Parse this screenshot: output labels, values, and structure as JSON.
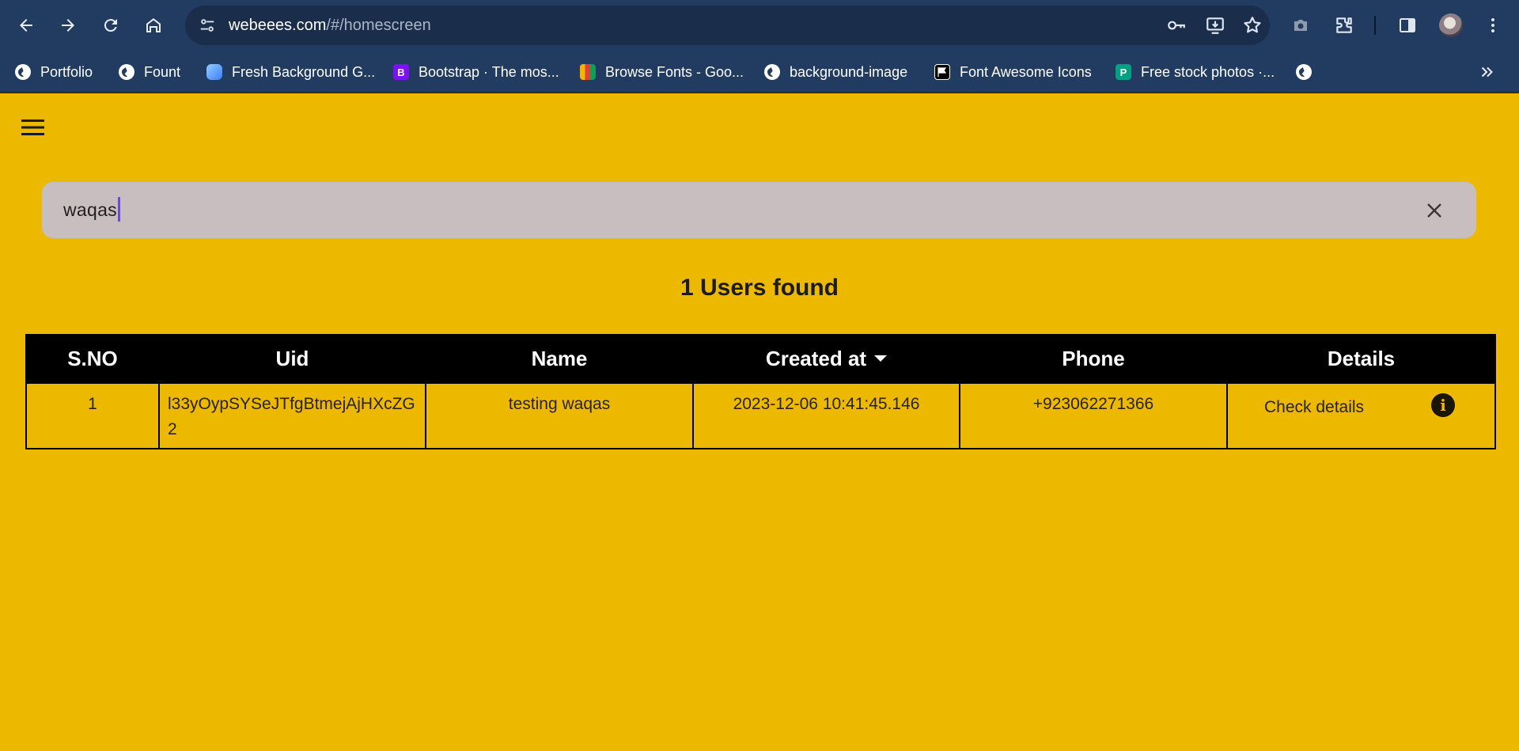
{
  "browser": {
    "url_host": "webeees.com",
    "url_path": "/#/homescreen",
    "bookmarks": [
      {
        "label": "Portfolio",
        "icon": "globe-icon"
      },
      {
        "label": "Fount",
        "icon": "globe-icon"
      },
      {
        "label": "Fresh Background G...",
        "icon": "fresh-background-icon"
      },
      {
        "label": "Bootstrap · The mos...",
        "icon": "bootstrap-icon",
        "glyph": "B"
      },
      {
        "label": "Browse Fonts - Goo...",
        "icon": "google-fonts-icon"
      },
      {
        "label": "background-image",
        "icon": "globe-icon"
      },
      {
        "label": "Font Awesome Icons",
        "icon": "font-awesome-icon"
      },
      {
        "label": "Free stock photos ·...",
        "icon": "pexels-icon",
        "glyph": "P"
      }
    ]
  },
  "app": {
    "search": {
      "value": "waqas"
    },
    "results_text": "1 Users found",
    "table": {
      "headers": [
        "S.NO",
        "Uid",
        "Name",
        "Created at",
        "Phone",
        "Details"
      ],
      "rows": [
        {
          "sno": "1",
          "uid": "l33yOypSYSeJTfgBtmejAjHXcZG2",
          "name": "testing waqas",
          "created_at": "2023-12-06 10:41:45.146",
          "phone": "+923062271366",
          "details_label": "Check details"
        }
      ]
    }
  },
  "colors": {
    "background": "#ECB800",
    "browser_chrome": "#223b60",
    "table_header": "#000000",
    "search_field": "#c9bebf"
  }
}
